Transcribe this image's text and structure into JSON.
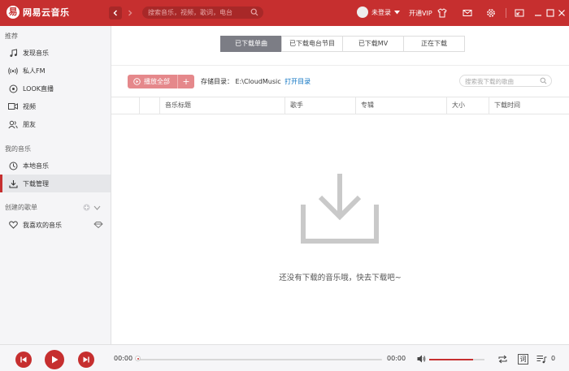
{
  "app": {
    "title": "网易云音乐",
    "logo_mark": "易"
  },
  "header": {
    "search_placeholder": "搜索音乐，视频，歌词，电台",
    "user_status": "未登录",
    "vip_label": "开通VIP",
    "icons": [
      "back-icon",
      "forward-icon",
      "search-icon",
      "user-dropdown-icon",
      "skin-icon",
      "mail-icon",
      "settings-icon",
      "mini-mode-icon",
      "minimize-icon",
      "maximize-icon",
      "close-icon"
    ]
  },
  "sidebar": {
    "recommend_title": "推荐",
    "recommend": [
      {
        "label": "发现音乐",
        "icon": "music-note-icon"
      },
      {
        "label": "私人FM",
        "icon": "radio-icon"
      },
      {
        "label": "LOOK直播",
        "icon": "live-icon"
      },
      {
        "label": "视频",
        "icon": "video-icon"
      },
      {
        "label": "朋友",
        "icon": "friends-icon"
      }
    ],
    "my_music_title": "我的音乐",
    "my_music": [
      {
        "label": "本地音乐",
        "icon": "local-music-icon"
      },
      {
        "label": "下载管理",
        "icon": "download-icon",
        "active": true
      }
    ],
    "created_title": "创建的歌单",
    "playlists": [
      {
        "label": "我喜欢的音乐",
        "icon": "heart-icon"
      }
    ]
  },
  "main": {
    "tabs": [
      "已下载单曲",
      "已下载电台节目",
      "已下载MV",
      "正在下载"
    ],
    "active_tab": 0,
    "play_all_label": "播放全部",
    "play_all_plus": "+",
    "storage_label": "存储目录：",
    "storage_path": "E:\\CloudMusic",
    "open_dir_label": "打开目录",
    "local_search_placeholder": "搜索我下载的歌曲",
    "columns": [
      "音乐标题",
      "歌手",
      "专辑",
      "大小",
      "下载时间"
    ],
    "empty_message": "还没有下载的音乐哦，快去下载吧~"
  },
  "player": {
    "current_time": "00:00",
    "total_time": "00:00",
    "progress": 0,
    "volume": 0.8,
    "lyric_label": "词",
    "playlist_count": "0"
  },
  "colors": {
    "brand": "#c62f2f",
    "sidebar_bg": "#f5f5f7",
    "link": "#0c73c2"
  }
}
